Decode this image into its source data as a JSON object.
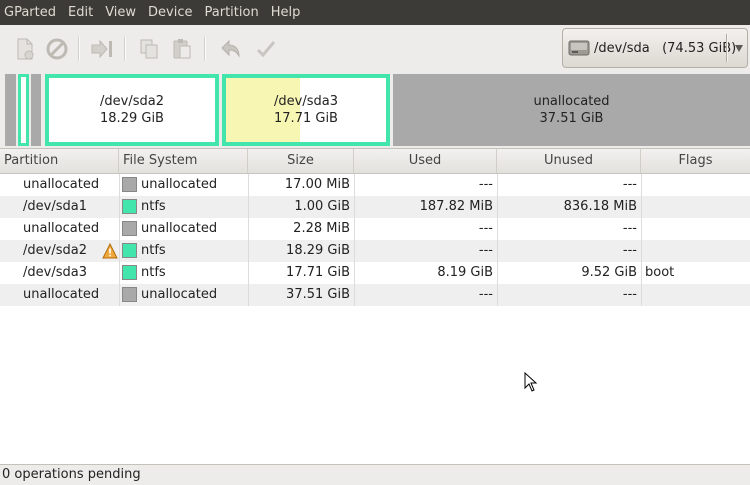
{
  "menubar": {
    "items": [
      "GParted",
      "Edit",
      "View",
      "Device",
      "Partition",
      "Help"
    ]
  },
  "toolbar": {
    "buttons": [
      {
        "icon": "new-partition-icon",
        "label": "New"
      },
      {
        "icon": "delete-icon",
        "label": "Delete"
      },
      {
        "icon": "resize-move-icon",
        "label": "Resize/Move"
      },
      {
        "icon": "copy-icon",
        "label": "Copy"
      },
      {
        "icon": "paste-icon",
        "label": "Paste"
      },
      {
        "icon": "undo-icon",
        "label": "Undo"
      },
      {
        "icon": "apply-icon",
        "label": "Apply"
      }
    ],
    "device_selector": {
      "value": "/dev/sda   (74.53 GiB)",
      "icon": "harddisk-icon"
    }
  },
  "graph": {
    "segments": [
      {
        "kind": "unallocated",
        "name": "",
        "size": ""
      },
      {
        "kind": "partition",
        "name": "",
        "size": ""
      },
      {
        "kind": "unallocated",
        "name": "",
        "size": ""
      },
      {
        "kind": "partition",
        "name": "/dev/sda2",
        "size": "18.29 GiB",
        "used_fraction": 0.0
      },
      {
        "kind": "partition",
        "name": "/dev/sda3",
        "size": "17.71 GiB",
        "used_fraction": 0.46
      },
      {
        "kind": "unallocated",
        "name": "unallocated",
        "size": "37.51 GiB"
      }
    ]
  },
  "table": {
    "columns": [
      "Partition",
      "File System",
      "Size",
      "Used",
      "Unused",
      "Flags"
    ],
    "rows": [
      {
        "partition": "unallocated",
        "fs": "unallocated",
        "fs_color": "#a9a9a9",
        "size": "17.00 MiB",
        "used": "---",
        "unused": "---",
        "flags": "",
        "warning": false
      },
      {
        "partition": "/dev/sda1",
        "fs": "ntfs",
        "fs_color": "#42e5ac",
        "size": "1.00 GiB",
        "used": "187.82 MiB",
        "unused": "836.18 MiB",
        "flags": "",
        "warning": false
      },
      {
        "partition": "unallocated",
        "fs": "unallocated",
        "fs_color": "#a9a9a9",
        "size": "2.28 MiB",
        "used": "---",
        "unused": "---",
        "flags": "",
        "warning": false
      },
      {
        "partition": "/dev/sda2",
        "fs": "ntfs",
        "fs_color": "#42e5ac",
        "size": "18.29 GiB",
        "used": "---",
        "unused": "---",
        "flags": "",
        "warning": true
      },
      {
        "partition": "/dev/sda3",
        "fs": "ntfs",
        "fs_color": "#42e5ac",
        "size": "17.71 GiB",
        "used": "8.19 GiB",
        "unused": "9.52 GiB",
        "flags": "boot",
        "warning": false
      },
      {
        "partition": "unallocated",
        "fs": "unallocated",
        "fs_color": "#a9a9a9",
        "size": "37.51 GiB",
        "used": "---",
        "unused": "---",
        "flags": "",
        "warning": false
      }
    ]
  },
  "statusbar": {
    "text": "0 operations pending"
  },
  "colors": {
    "ntfs": "#42e5ac",
    "unallocated": "#a9a9a9",
    "used_space": "#f7f7b3",
    "menubar_bg": "#3c3b37"
  }
}
